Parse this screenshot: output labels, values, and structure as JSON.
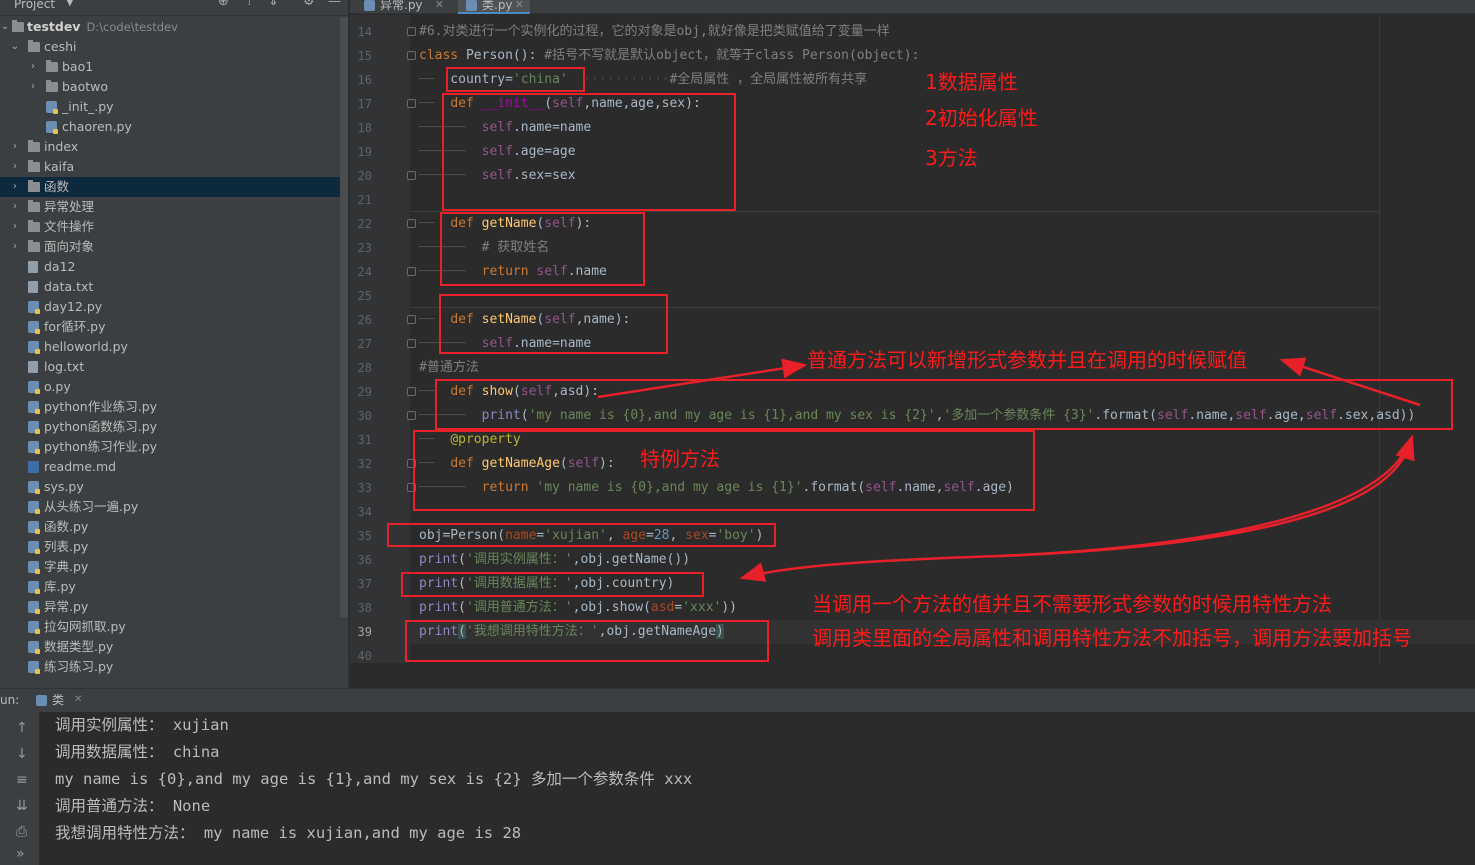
{
  "project_panel": {
    "title": "Project",
    "root": {
      "name": "testdev",
      "path": "D:\\code\\testdev"
    },
    "items": [
      {
        "label": "ceshi",
        "type": "folder",
        "expanded": true,
        "depth": 1
      },
      {
        "label": "bao1",
        "type": "folder",
        "depth": 2
      },
      {
        "label": "baotwo",
        "type": "folder",
        "depth": 2
      },
      {
        "label": "_init_.py",
        "type": "py",
        "depth": 2
      },
      {
        "label": "chaoren.py",
        "type": "py",
        "depth": 2
      },
      {
        "label": "index",
        "type": "folder",
        "depth": 1
      },
      {
        "label": "kaifa",
        "type": "folder",
        "depth": 1
      },
      {
        "label": "函数",
        "type": "folder",
        "depth": 1,
        "selected": true
      },
      {
        "label": "异常处理",
        "type": "folder",
        "depth": 1
      },
      {
        "label": "文件操作",
        "type": "folder",
        "depth": 1
      },
      {
        "label": "面向对象",
        "type": "folder",
        "depth": 1
      },
      {
        "label": "da12",
        "type": "txt",
        "depth": 1
      },
      {
        "label": "data.txt",
        "type": "txt",
        "depth": 1
      },
      {
        "label": "day12.py",
        "type": "py",
        "depth": 1
      },
      {
        "label": "for循环.py",
        "type": "py",
        "depth": 1
      },
      {
        "label": "helloworld.py",
        "type": "py",
        "depth": 1
      },
      {
        "label": "log.txt",
        "type": "txt",
        "depth": 1
      },
      {
        "label": "o.py",
        "type": "py",
        "depth": 1
      },
      {
        "label": "python作业练习.py",
        "type": "py",
        "depth": 1
      },
      {
        "label": "python函数练习.py",
        "type": "py",
        "depth": 1
      },
      {
        "label": "python练习作业.py",
        "type": "py",
        "depth": 1
      },
      {
        "label": "readme.md",
        "type": "md",
        "depth": 1
      },
      {
        "label": "sys.py",
        "type": "py",
        "depth": 1
      },
      {
        "label": "从头练习一遍.py",
        "type": "py",
        "depth": 1
      },
      {
        "label": "函数.py",
        "type": "py",
        "depth": 1
      },
      {
        "label": "列表.py",
        "type": "py",
        "depth": 1
      },
      {
        "label": "字典.py",
        "type": "py",
        "depth": 1
      },
      {
        "label": "库.py",
        "type": "py",
        "depth": 1
      },
      {
        "label": "异常.py",
        "type": "py",
        "depth": 1
      },
      {
        "label": "拉勾网抓取.py",
        "type": "py",
        "depth": 1
      },
      {
        "label": "数据类型.py",
        "type": "py",
        "depth": 1
      },
      {
        "label": "练习练习.py",
        "type": "py",
        "depth": 1
      }
    ]
  },
  "editor_tabs": [
    {
      "label": "异常.py",
      "active": false
    },
    {
      "label": "类.py",
      "active": true
    }
  ],
  "editor": {
    "line_numbers": [
      "14",
      "15",
      "16",
      "17",
      "18",
      "19",
      "20",
      "21",
      "22",
      "23",
      "24",
      "25",
      "26",
      "27",
      "28",
      "29",
      "30",
      "31",
      "32",
      "33",
      "34",
      "35",
      "36",
      "37",
      "38",
      "39",
      "40"
    ],
    "current_line": "39"
  },
  "annotations": {
    "data_attr": "1数据属性",
    "init_attr": "2初始化属性",
    "method": "3方法",
    "normal_method": "普通方法可以新增形式参数并且在调用的时候赋值",
    "special_method": "特例方法",
    "property_note": "当调用一个方法的值并且不需要形式参数的时候用特性方法",
    "paren_note": "调用类里面的全局属性和调用特性方法不加括号，调用方法要加括号"
  },
  "run_panel": {
    "label": "un:",
    "tab": "类",
    "output": [
      "调用实例属性： xujian",
      "调用数据属性： china",
      "my name is {0},and my age is {1},and my sex is {2} 多加一个参数条件 xxx",
      "调用普通方法： None",
      "我想调用特性方法： my name is xujian,and my age is 28"
    ]
  },
  "colors": {
    "annotation_red": "#e8202a",
    "selection": "#0d293e",
    "editor_bg": "#2b2b2b",
    "panel_bg": "#3c3f41"
  }
}
